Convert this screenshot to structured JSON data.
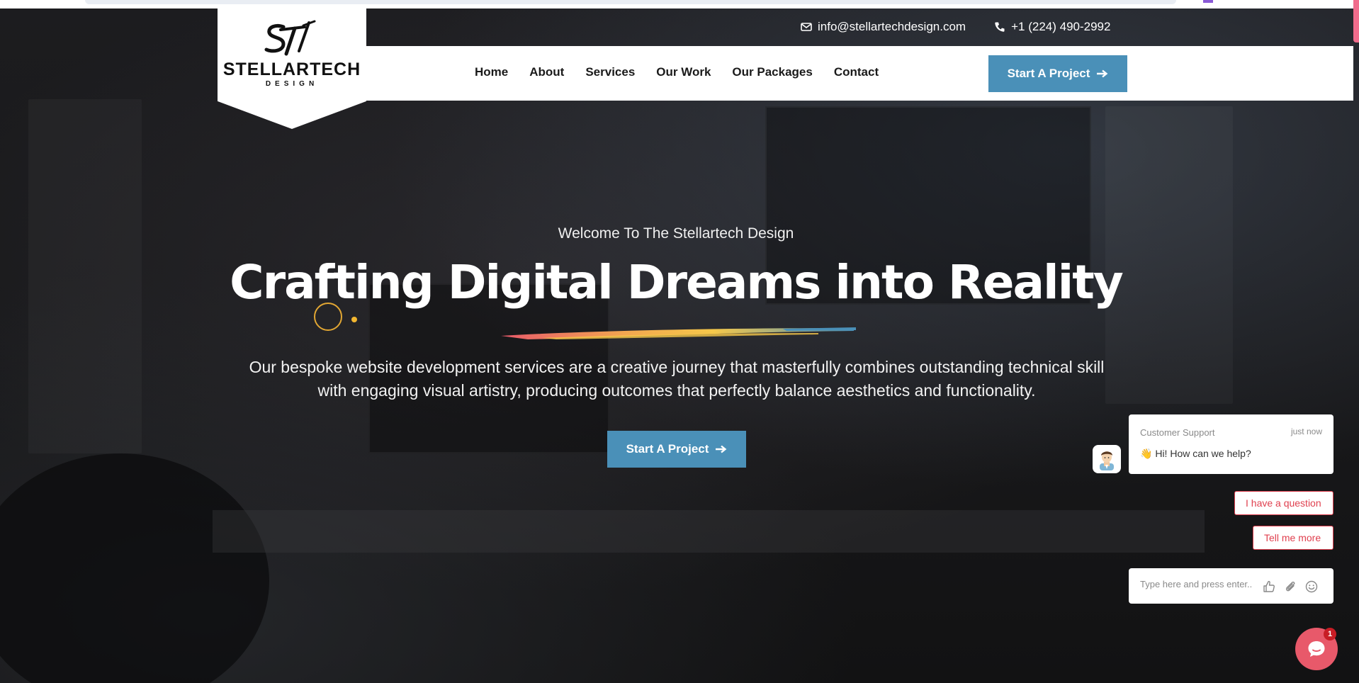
{
  "brand": {
    "name": "STELLARTECH",
    "subtitle": "DESIGN",
    "logo_mark": "ST"
  },
  "contact": {
    "email": "info@stellartechdesign.com",
    "phone": "+1 (224) 490-2992",
    "email_icon": "envelope-icon",
    "phone_icon": "phone-icon"
  },
  "nav": {
    "items": [
      {
        "label": "Home"
      },
      {
        "label": "About"
      },
      {
        "label": "Services"
      },
      {
        "label": "Our Work"
      },
      {
        "label": "Our Packages"
      },
      {
        "label": "Contact"
      }
    ],
    "cta_label": "Start A Project"
  },
  "hero": {
    "eyebrow": "Welcome To The Stellartech Design",
    "title": "Crafting Digital Dreams into Reality",
    "description_line1": "Our bespoke website development services are a creative journey that masterfully combines outstanding technical skill",
    "description_line2": "with engaging visual artistry, producing outcomes that perfectly balance aesthetics and functionality.",
    "cta_label": "Start A Project"
  },
  "chat": {
    "sender": "Customer Support",
    "time": "just now",
    "message": "Hi! How can we help?",
    "message_emoji": "👋",
    "quick_replies": [
      "I have a question",
      "Tell me more"
    ],
    "input_placeholder": "Type here and press enter..",
    "unread_count": "1"
  },
  "colors": {
    "accent": "#4a90b8",
    "chat_accent": "#e0404f",
    "launcher": "#e8596a",
    "deco": "#f2b630"
  }
}
